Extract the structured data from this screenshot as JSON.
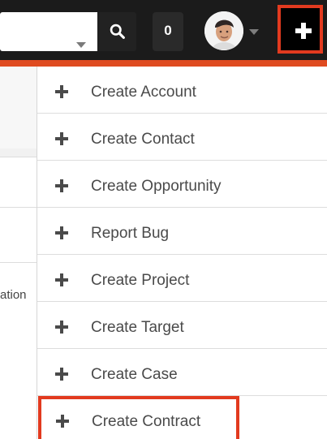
{
  "header": {
    "search": {
      "value": "",
      "placeholder": ""
    },
    "notification_count": "0",
    "avatar_icon": "user-avatar",
    "quick_create_icon": "plus-icon",
    "accent_color": "#df4b20",
    "highlight_color": "#e23a1f"
  },
  "background": {
    "partial_text": "ation"
  },
  "quick_create_menu": {
    "items": [
      {
        "label": "Create Account",
        "icon": "plus-icon"
      },
      {
        "label": "Create Contact",
        "icon": "plus-icon"
      },
      {
        "label": "Create Opportunity",
        "icon": "plus-icon"
      },
      {
        "label": "Report Bug",
        "icon": "plus-icon"
      },
      {
        "label": "Create Project",
        "icon": "plus-icon"
      },
      {
        "label": "Create Target",
        "icon": "plus-icon"
      },
      {
        "label": "Create Case",
        "icon": "plus-icon"
      },
      {
        "label": "Create Contract",
        "icon": "plus-icon",
        "highlighted": true
      }
    ]
  }
}
